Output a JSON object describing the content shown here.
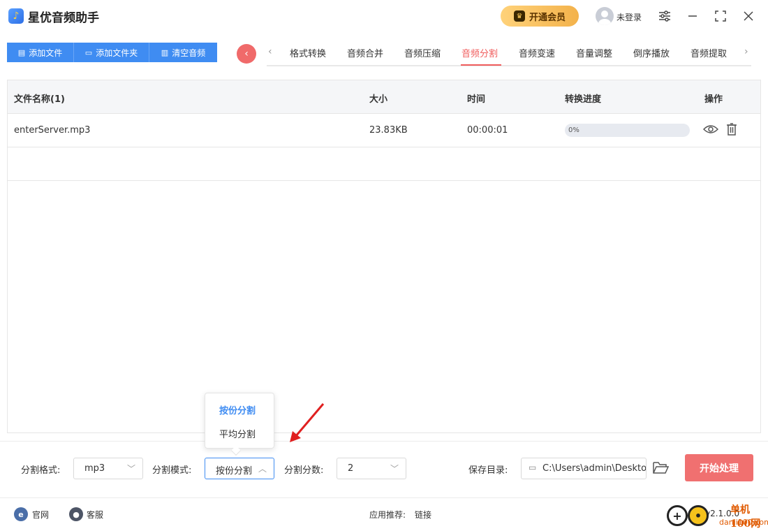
{
  "app": {
    "title": "星优音频助手",
    "vip_label": "开通会员",
    "login_label": "未登录"
  },
  "toolbar": [
    {
      "label": "添加文件",
      "icon": "file-icon"
    },
    {
      "label": "添加文件夹",
      "icon": "folder-icon"
    },
    {
      "label": "清空音频",
      "icon": "trash-icon"
    }
  ],
  "tabs": [
    {
      "label": "格式转换"
    },
    {
      "label": "音频合并"
    },
    {
      "label": "音频压缩"
    },
    {
      "label": "音频分割",
      "active": true
    },
    {
      "label": "音频变速"
    },
    {
      "label": "音量调整"
    },
    {
      "label": "倒序播放"
    },
    {
      "label": "音频提取"
    }
  ],
  "table": {
    "headers": {
      "name": "文件名称(1)",
      "size": "大小",
      "time": "时间",
      "progress": "转换进度",
      "ops": "操作"
    },
    "rows": [
      {
        "name": "enterServer.mp3",
        "size": "23.83KB",
        "time": "00:00:01",
        "progress_text": "0%",
        "progress": 0
      }
    ]
  },
  "settings": {
    "format_label": "分割格式:",
    "format_value": "mp3",
    "mode_label": "分割模式:",
    "mode_value": "按份分割",
    "count_label": "分割分数:",
    "count_value": "2",
    "dir_label": "保存目录:",
    "dir_value": "C:\\Users\\admin\\Deskto",
    "start_label": "开始处理"
  },
  "dropdown": {
    "options": [
      "按份分割",
      "平均分割"
    ],
    "selected": "按份分割"
  },
  "footer": {
    "official": "官网",
    "service": "客服",
    "recommend_label": "应用推荐:",
    "recommend_link": "链接",
    "version": "v2.1.0.0"
  },
  "watermark": {
    "brand": "单机100网",
    "domain": "danji100.com"
  },
  "colors": {
    "accent": "#3f8cf2",
    "danger": "#f06a6a",
    "vip": "#f3b24b"
  }
}
